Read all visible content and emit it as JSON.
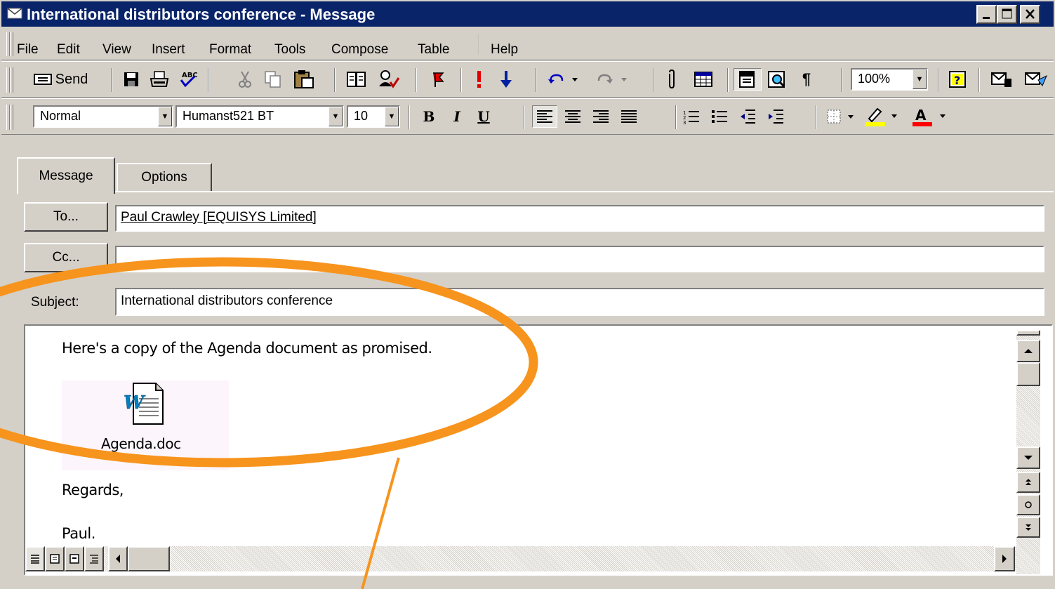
{
  "window": {
    "title": "International distributors conference - Message",
    "controls": {
      "minimize": "_",
      "maximize": "□",
      "close": "×"
    }
  },
  "menu": [
    "File",
    "Edit",
    "View",
    "Insert",
    "Format",
    "Tools",
    "Compose",
    "Table",
    "Help"
  ],
  "toolbar": {
    "send_label": "Send",
    "zoom": "100%",
    "icons": [
      "send-icon",
      "save-icon",
      "print-icon",
      "spelling-icon",
      "cut-icon",
      "copy-icon",
      "paste-icon",
      "address-book-icon",
      "check-names-icon",
      "flag-icon",
      "importance-high-icon",
      "importance-low-icon",
      "undo-icon",
      "redo-icon",
      "attach-icon",
      "insert-table-icon",
      "show-from-icon",
      "find-icon",
      "show-formatting-icon",
      "help-icon",
      "send-receive-icon",
      "options-icon"
    ]
  },
  "format": {
    "style": "Normal",
    "font": "Humanst521 BT",
    "size": "10",
    "bold": "B",
    "italic": "I",
    "underline": "U"
  },
  "tabs": [
    {
      "label": "Message",
      "active": true
    },
    {
      "label": "Options",
      "active": false
    }
  ],
  "header": {
    "to_button": "To...",
    "to_value": "Paul Crawley [EQUISYS Limited]",
    "cc_button": "Cc...",
    "cc_value": "",
    "subject_label": "Subject:",
    "subject_value": "International distributors conference"
  },
  "body": {
    "line1": "Here's a copy of the Agenda document as promised.",
    "attachment_name": "Agenda.doc",
    "closing": "Regards,",
    "signature": "Paul."
  },
  "colors": {
    "titlebar": "#0a246a",
    "face": "#d4d0c8",
    "annotation": "#f7941d",
    "highlight_swatch": "#ffff00",
    "font_color_swatch": "#ff0000"
  }
}
